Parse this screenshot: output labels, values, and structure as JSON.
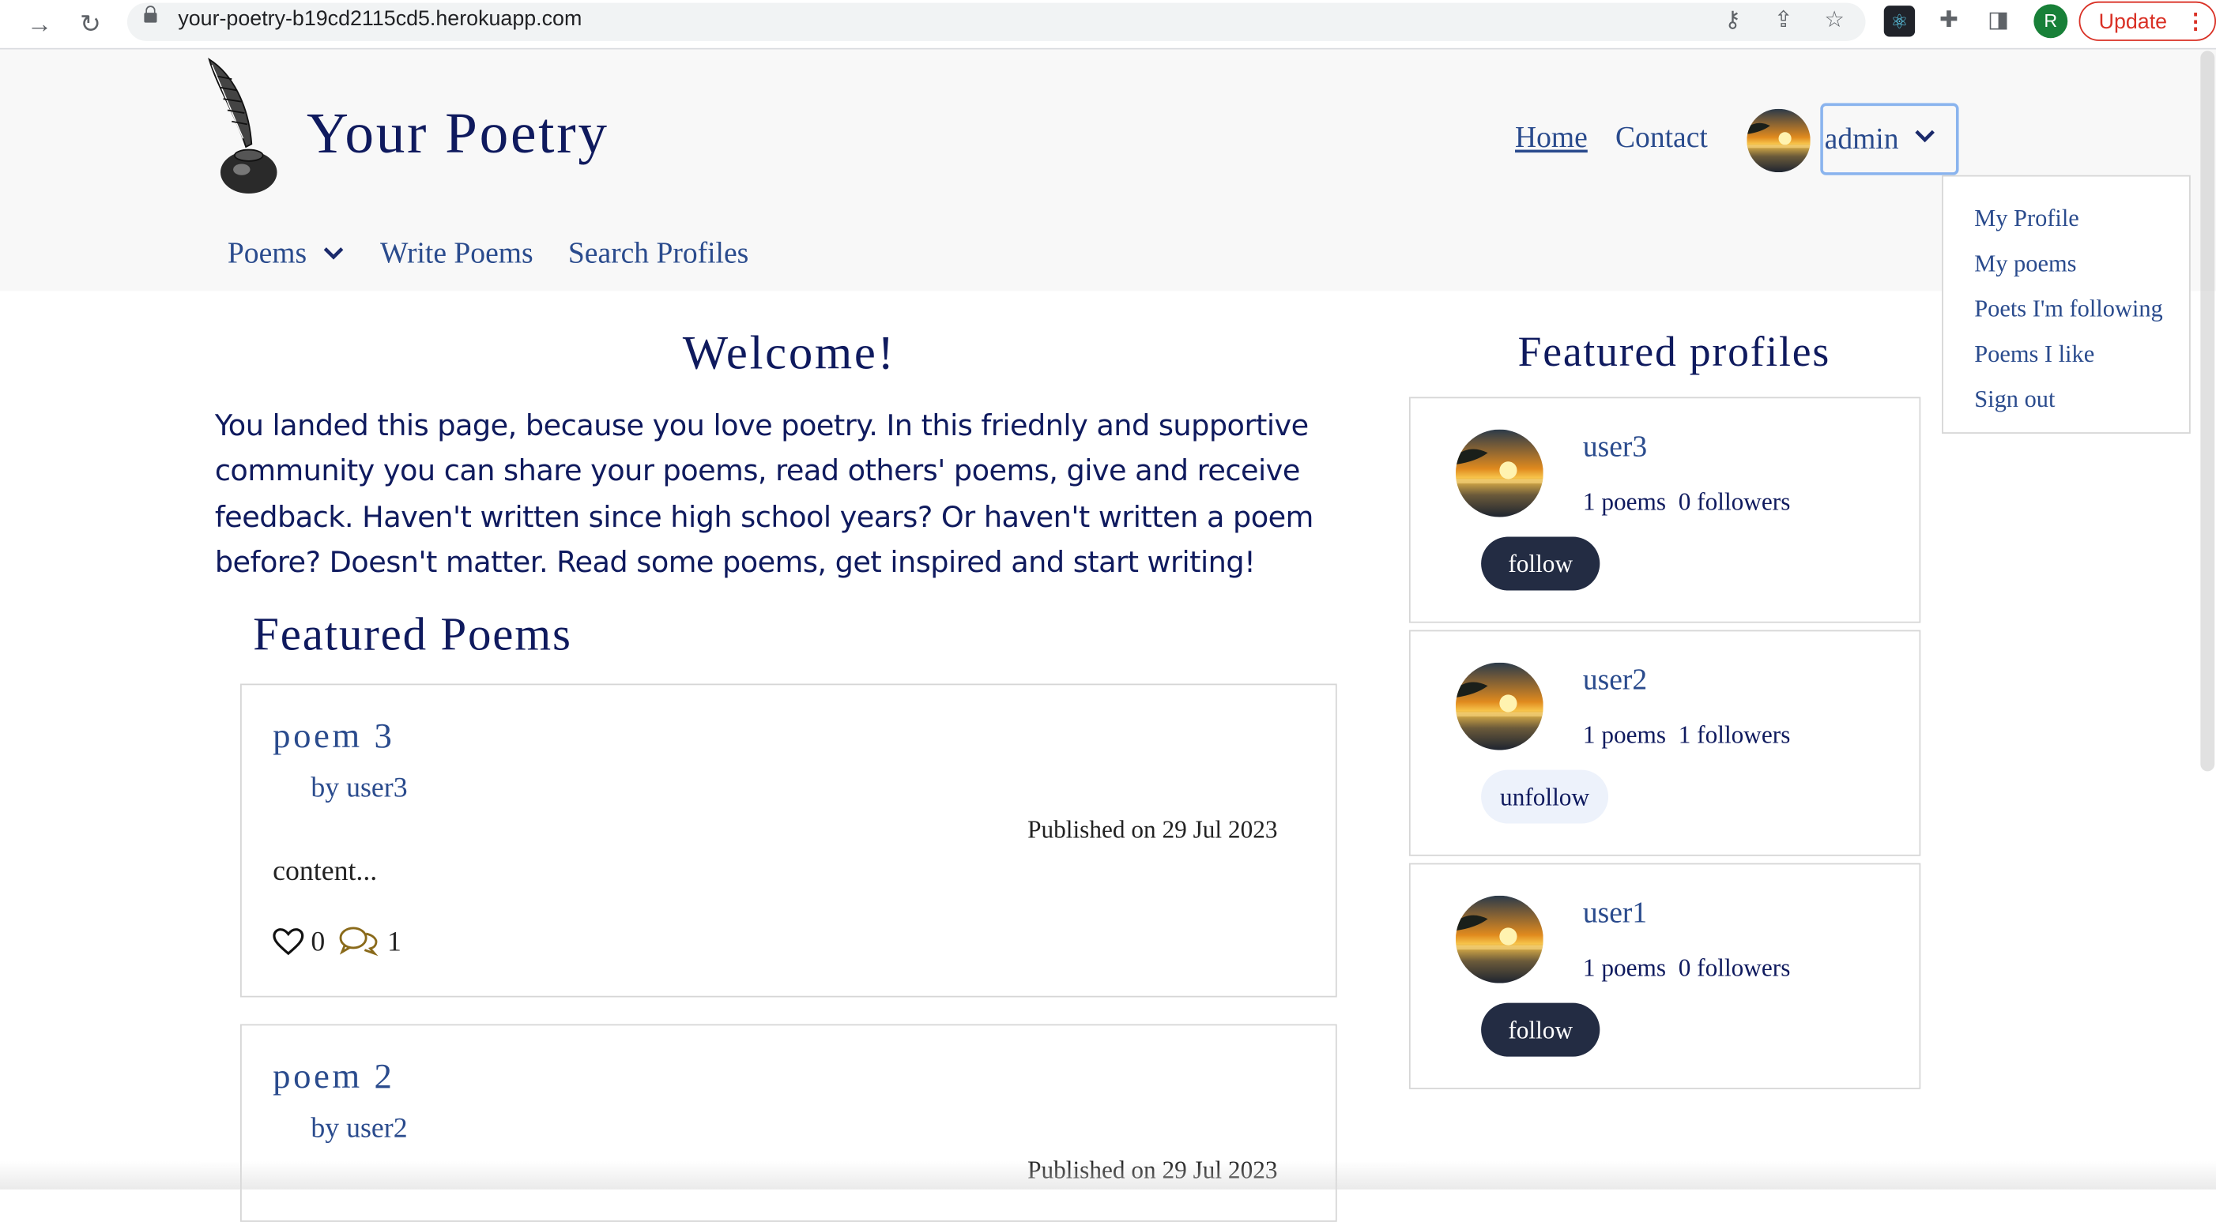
{
  "browser": {
    "url": "your-poetry-b19cd2115cd5.herokuapp.com",
    "profile_initial": "R",
    "update_label": "Update"
  },
  "site": {
    "title": "Your Poetry",
    "nav": {
      "home": "Home",
      "contact": "Contact",
      "user": "admin"
    },
    "user_menu": [
      "My Profile",
      "My poems",
      "Poets I'm following",
      "Poems I like",
      "Sign out"
    ],
    "subnav": {
      "poems": "Poems",
      "write": "Write Poems",
      "search": "Search Profiles"
    }
  },
  "main": {
    "welcome": "Welcome!",
    "intro": "You landed this page, because you love poetry. In this friednly and supportive community you can share your poems, read others' poems, give and receive feedback. Haven't written since high school years? Or haven't written a poem before? Doesn't matter. Read some poems, get inspired and start writing!",
    "featured_poems_title": "Featured Poems",
    "poems": [
      {
        "title": "poem 3",
        "author": "by user3",
        "published": "Published on 29 Jul 2023",
        "content": "content...",
        "likes": "0",
        "comments": "1"
      },
      {
        "title": "poem 2",
        "author": "by user2",
        "published": "Published on 29 Jul 2023"
      }
    ]
  },
  "sidebar": {
    "title": "Featured profiles",
    "profiles": [
      {
        "name": "user3",
        "poems": "1 poems",
        "followers": "0 followers",
        "action": "follow"
      },
      {
        "name": "user2",
        "poems": "1 poems",
        "followers": "1 followers",
        "action": "unfollow"
      },
      {
        "name": "user1",
        "poems": "1 poems",
        "followers": "0 followers",
        "action": "follow"
      }
    ]
  },
  "colors": {
    "navy": "#0f1a5e",
    "link": "#2a4b8d",
    "dark_button": "#232c43",
    "light_button": "#edf2fb",
    "update_red": "#d93025"
  }
}
